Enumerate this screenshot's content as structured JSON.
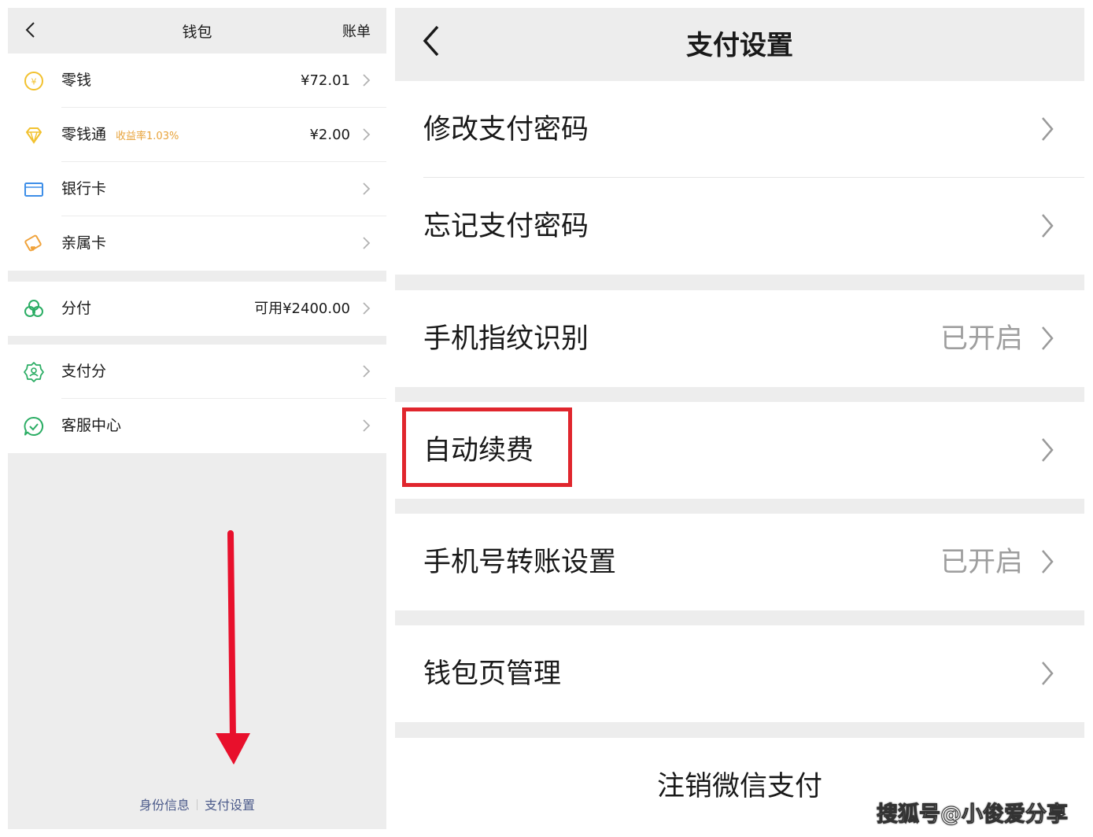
{
  "wallet": {
    "title": "钱包",
    "bill_label": "账单",
    "items_group1": [
      {
        "label": "零钱",
        "tag": "",
        "value": "¥72.01",
        "icon": "yuan-coin-icon"
      },
      {
        "label": "零钱通",
        "tag": "收益率1.03%",
        "value": "¥2.00",
        "icon": "diamond-icon"
      },
      {
        "label": "银行卡",
        "tag": "",
        "value": "",
        "icon": "bank-card-icon"
      },
      {
        "label": "亲属卡",
        "tag": "",
        "value": "",
        "icon": "family-card-icon"
      }
    ],
    "items_group2": [
      {
        "label": "分付",
        "value": "可用¥2400.00",
        "icon": "fenfu-icon"
      }
    ],
    "items_group3": [
      {
        "label": "支付分",
        "value": "",
        "icon": "pay-score-icon"
      },
      {
        "label": "客服中心",
        "value": "",
        "icon": "customer-service-icon"
      }
    ],
    "footer": {
      "identity_label": "身份信息",
      "pay_settings_label": "支付设置"
    }
  },
  "pay_settings": {
    "title": "支付设置",
    "group1": [
      {
        "label": "修改支付密码",
        "value": ""
      },
      {
        "label": "忘记支付密码",
        "value": ""
      }
    ],
    "group2": [
      {
        "label": "手机指纹识别",
        "value": "已开启"
      }
    ],
    "group3": [
      {
        "label": "自动续费",
        "value": ""
      }
    ],
    "group4": [
      {
        "label": "手机号转账设置",
        "value": "已开启"
      }
    ],
    "group5": [
      {
        "label": "钱包页管理",
        "value": ""
      }
    ],
    "cancel_label": "注销微信支付"
  },
  "watermark": "搜狐号@小俊爱分享",
  "colors": {
    "background_gray": "#ededed",
    "highlight_red": "#e0262d",
    "arrow_red": "#e8102c",
    "tag_orange": "#e8a33a",
    "footer_link": "#4b5a8a",
    "wechat_green": "#07c160"
  }
}
